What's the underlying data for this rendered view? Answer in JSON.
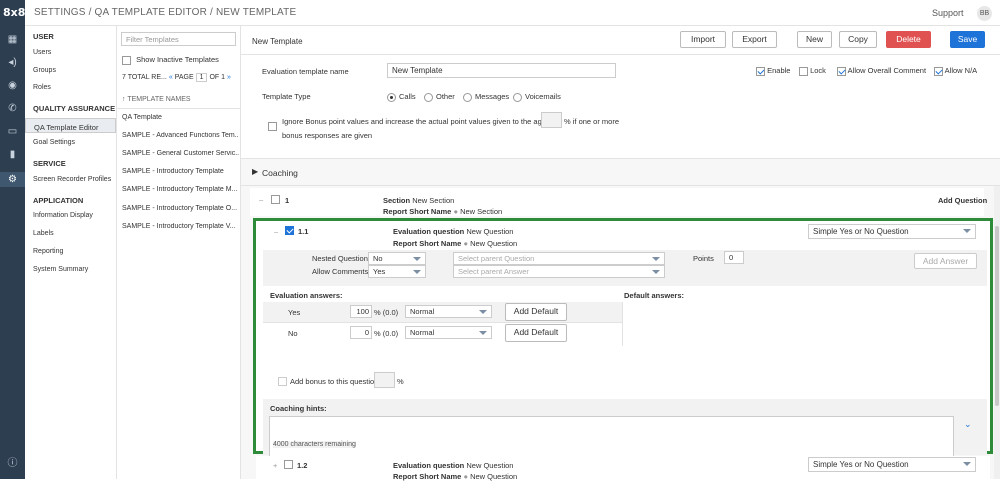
{
  "app": {
    "logo": "8x8",
    "breadcrumb": "SETTINGS / QA TEMPLATE EDITOR / NEW TEMPLATE",
    "support": "Support",
    "avatar": "BB"
  },
  "nav": {
    "user": {
      "heading": "USER",
      "items": [
        "Users",
        "Groups",
        "Roles"
      ]
    },
    "qa": {
      "heading": "QUALITY ASSURANCE",
      "items": [
        "QA Template Editor",
        "Goal Settings"
      ]
    },
    "service": {
      "heading": "SERVICE",
      "items": [
        "Screen Recorder Profiles"
      ]
    },
    "application": {
      "heading": "APPLICATION",
      "items": [
        "Information Display",
        "Labels",
        "Reporting",
        "System Summary"
      ]
    }
  },
  "templates": {
    "filter_placeholder": "Filter Templates",
    "show_inactive": "Show Inactive Templates",
    "total": "7 TOTAL RE...",
    "page_label": "PAGE",
    "page": "1",
    "of": "OF 1",
    "column": "TEMPLATE NAMES",
    "items": [
      "QA Template",
      "SAMPLE - Advanced Functions Tem...",
      "SAMPLE - General Customer Servic...",
      "SAMPLE - Introductory Template",
      "SAMPLE - Introductory Template M...",
      "SAMPLE - Introductory Template O...",
      "SAMPLE - Introductory Template V..."
    ]
  },
  "editor": {
    "title": "New Template",
    "buttons": {
      "import": "Import",
      "export": "Export",
      "new": "New",
      "copy": "Copy",
      "delete": "Delete",
      "save": "Save"
    },
    "name_label": "Evaluation template name",
    "name_value": "New Template",
    "flags": {
      "enable": "Enable",
      "lock": "Lock",
      "allow_overall": "Allow Overall Comment",
      "allow_na": "Allow N/A"
    },
    "type_label": "Template Type",
    "types": [
      "Calls",
      "Other",
      "Messages",
      "Voicemails"
    ],
    "bonus_text_1": "Ignore Bonus point values and increase the actual point values given to the agent by",
    "bonus_text_2": "% if one or more",
    "bonus_text_3": "bonus responses are given",
    "coaching": "Coaching",
    "add_question": "Add Question",
    "section": {
      "num": "1",
      "label": "Section",
      "value": "New Section",
      "short_label": "Report Short Name",
      "short_value": "New Section"
    },
    "q1": {
      "num": "1.1",
      "label": "Evaluation question",
      "value": "New Question",
      "short_label": "Report Short Name",
      "short_value": "New Question",
      "type": "Simple Yes or No Question",
      "nested_label": "Nested Question",
      "nested_value": "No",
      "allow_comments_label": "Allow Comments",
      "allow_comments_value": "Yes",
      "parent_q_ph": "Select parent Question",
      "parent_a_ph": "Select parent Answer",
      "points_label": "Points",
      "points_value": "0",
      "add_answer": "Add Answer",
      "eval_answers": "Evaluation answers:",
      "default_answers": "Default answers:",
      "answers": [
        {
          "label": "Yes",
          "value": "100",
          "pct": "% (0.0)",
          "level": "Normal",
          "btn": "Add Default"
        },
        {
          "label": "No",
          "value": "0",
          "pct": "% (0.0)",
          "level": "Normal",
          "btn": "Add Default"
        }
      ],
      "bonus": "Add bonus to this question:",
      "bonus_pct": "%",
      "hints": "Coaching hints:",
      "remaining": "4000 characters remaining"
    },
    "q2": {
      "num": "1.2",
      "label": "Evaluation question",
      "value": "New Question",
      "short_label": "Report Short Name",
      "short_value": "New Question",
      "type": "Simple Yes or No Question"
    }
  },
  "colors": {
    "rail": "#2d3e50",
    "delete": "#e05252",
    "save": "#1e73d8",
    "highlight": "#2e8b3a"
  }
}
